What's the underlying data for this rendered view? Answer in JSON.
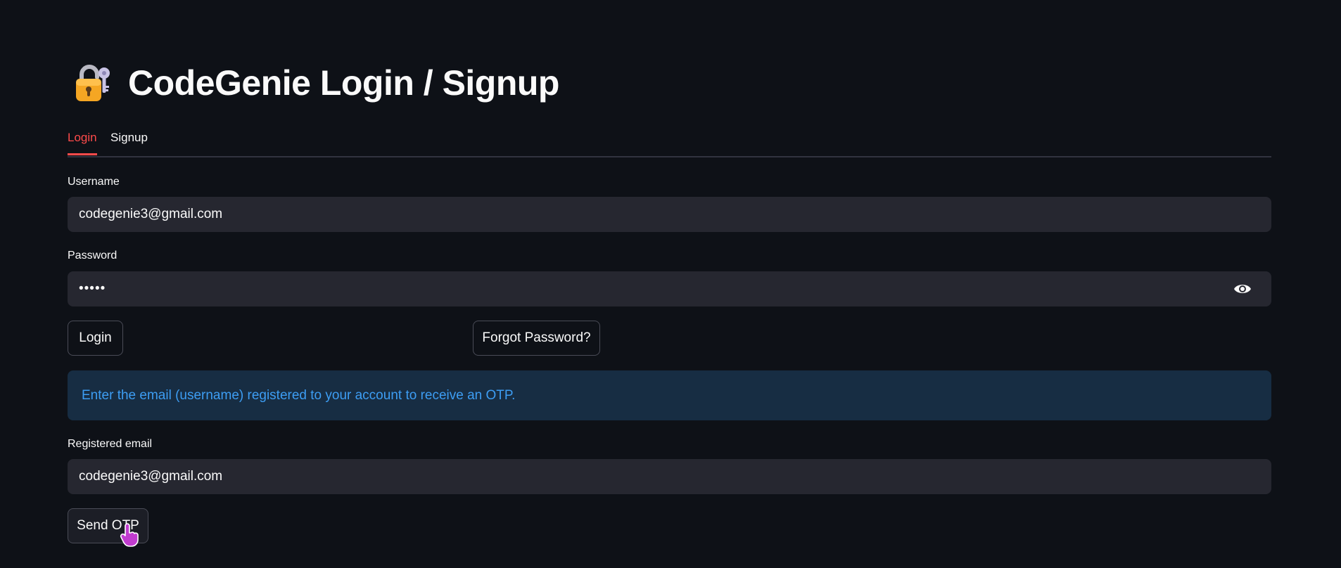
{
  "header": {
    "title": "CodeGenie Login / Signup",
    "icon": "lock-with-key-icon"
  },
  "tabs": [
    {
      "label": "Login",
      "active": true
    },
    {
      "label": "Signup",
      "active": false
    }
  ],
  "login": {
    "username_label": "Username",
    "username_value": "codegenie3@gmail.com",
    "password_label": "Password",
    "password_value": "•••••",
    "login_button": "Login",
    "forgot_button": "Forgot Password?"
  },
  "forgot": {
    "info_text": "Enter the email (username) registered to your account to receive an OTP.",
    "email_label": "Registered email",
    "email_value": "codegenie3@gmail.com",
    "send_button": "Send OTP"
  },
  "colors": {
    "background": "#0e1117",
    "accent": "#ff4b4b",
    "input_bg": "#262730",
    "info_bg": "#172d43",
    "info_text": "#3d9df3"
  }
}
